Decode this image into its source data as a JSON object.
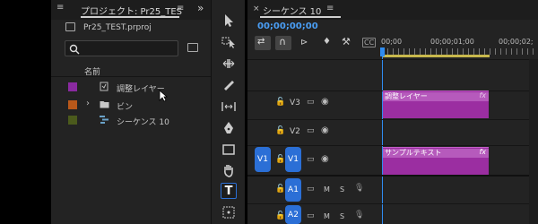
{
  "project": {
    "title": "プロジェクト: Pr25_TES",
    "menu_icon": "≡",
    "more_icon": "»",
    "file_name": "Pr25_TEST.prproj",
    "search_placeholder": "",
    "column_name": "名前",
    "items": [
      {
        "label": "調整レイヤー",
        "color": "#8a2aa0",
        "icon": "adjustment-layer-icon"
      },
      {
        "label": "ビン",
        "color": "#b8581a",
        "icon": "folder-icon"
      },
      {
        "label": "シーケンス 10",
        "color": "#4b5a1c",
        "icon": "sequence-icon"
      }
    ]
  },
  "tools": [
    "selection",
    "track-select",
    "ripple-edit",
    "razor",
    "slip",
    "pen",
    "rectangle",
    "hand",
    "type",
    "transform"
  ],
  "timeline": {
    "tab_close": "×",
    "tab_title": "シーケンス 10",
    "tab_menu": "≡",
    "timecode": "00;00;00;00",
    "ruler": [
      "00;00",
      "00;00;01;00",
      "00;00;02;"
    ],
    "tracks": [
      {
        "name": "V3"
      },
      {
        "name": "V2"
      },
      {
        "name": "V1",
        "source": "V1"
      },
      {
        "name": "A1",
        "m": "M",
        "s": "S"
      },
      {
        "name": "A2",
        "m": "M",
        "s": "S"
      }
    ],
    "clips": [
      {
        "label": "調整レイヤー",
        "fx": "fx"
      },
      {
        "label": "サンプルテキスト",
        "fx": "fx"
      }
    ]
  }
}
